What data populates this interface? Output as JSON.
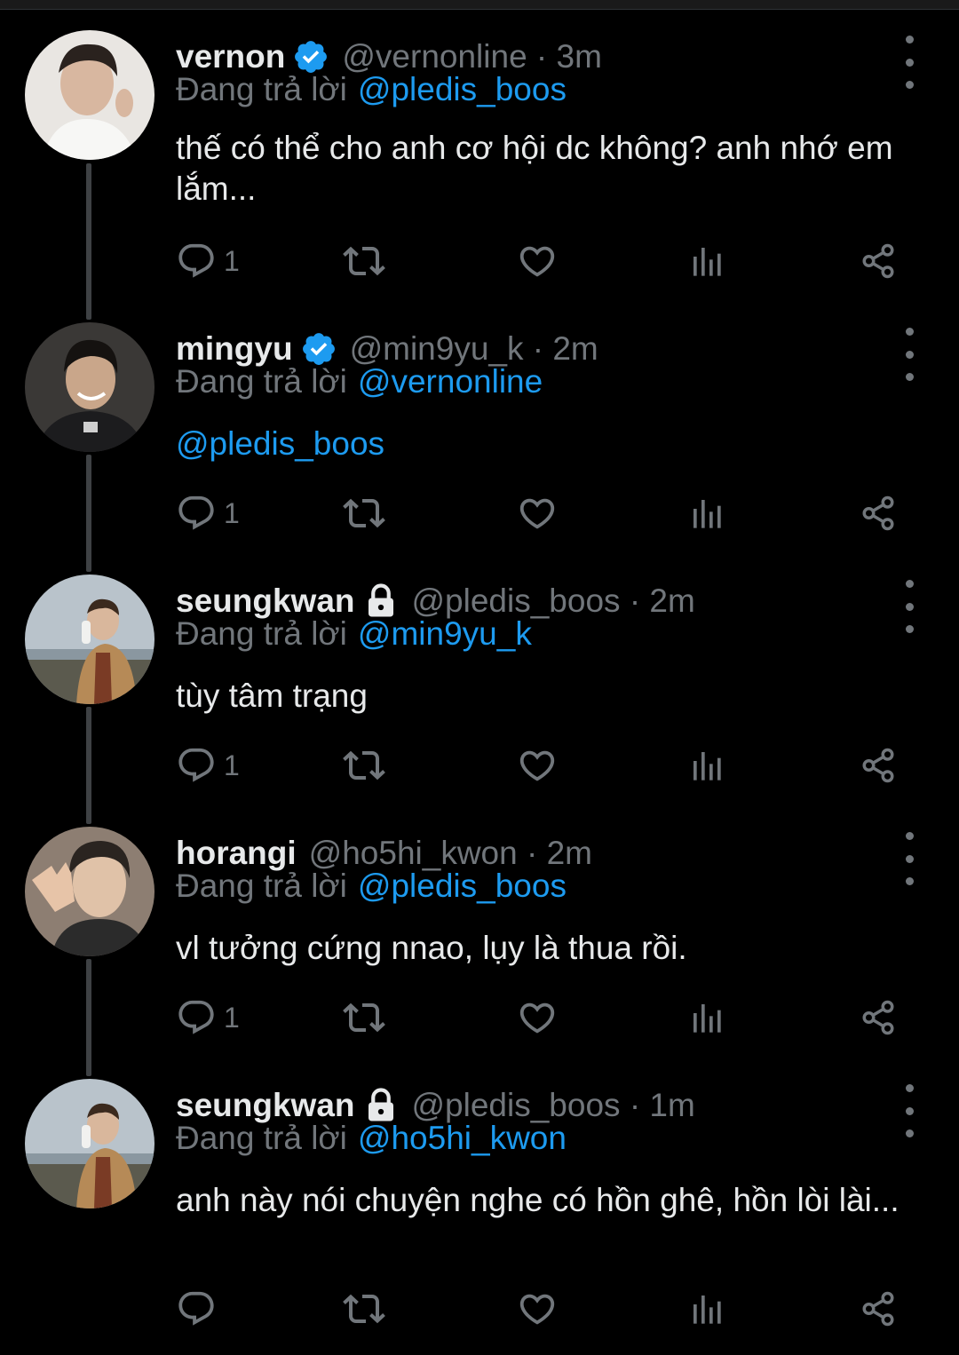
{
  "colors": {
    "background": "#000000",
    "text": "#e7e9ea",
    "muted": "#71767b",
    "accent": "#1d9bf0",
    "verified": "#1d9bf0",
    "thread_line": "#3e4144"
  },
  "replying_prefix": "Đang trả lời",
  "tweets": [
    {
      "name": "vernon",
      "verified": true,
      "locked": false,
      "handle": "@vernonline · 3m",
      "reply_to": "@pledis_boos",
      "text": "thế có thể cho anh cơ hội dc không? anh nhớ em lắm...",
      "reply_count": "1",
      "avatar_icon": "avatar-photo"
    },
    {
      "name": "mingyu",
      "verified": true,
      "locked": false,
      "handle": "@min9yu_k · 2m",
      "reply_to": "@vernonline",
      "text": "@pledis_boos",
      "reply_count": "1",
      "avatar_icon": "avatar-photo"
    },
    {
      "name": "seungkwan",
      "verified": false,
      "locked": true,
      "handle": "@pledis_boos · 2m",
      "reply_to": "@min9yu_k",
      "text": "tùy tâm trạng",
      "reply_count": "1",
      "avatar_icon": "avatar-photo"
    },
    {
      "name": "horangi",
      "verified": false,
      "locked": false,
      "handle": "@ho5hi_kwon · 2m",
      "reply_to": "@pledis_boos",
      "text": "vl tưởng cứng nnao, lụy là thua rồi.",
      "reply_count": "1",
      "avatar_icon": "avatar-photo"
    },
    {
      "name": "seungkwan",
      "verified": false,
      "locked": true,
      "handle": "@pledis_boos · 1m",
      "reply_to": "@ho5hi_kwon",
      "text": "anh này nói chuyện nghe có hồn ghê, hồn lòi lài...",
      "reply_count": "",
      "avatar_icon": "avatar-photo"
    }
  ],
  "icons": {
    "reply": "reply-icon",
    "retweet": "retweet-icon",
    "like": "heart-icon",
    "views": "analytics-icon",
    "share": "share-icon",
    "more": "more-vertical-icon",
    "verified": "verified-badge-icon",
    "lock": "lock-icon"
  }
}
